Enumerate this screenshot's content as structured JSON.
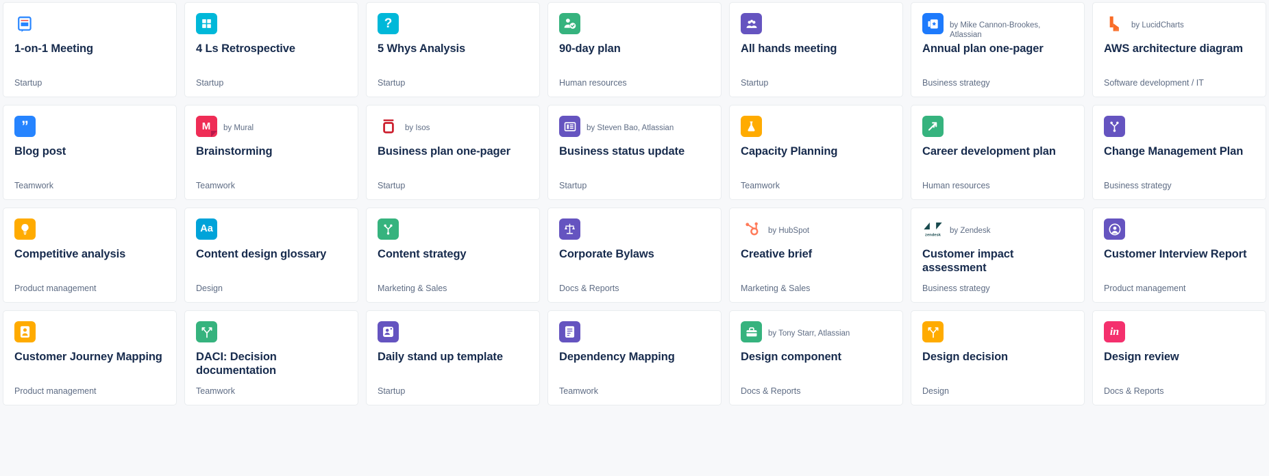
{
  "gallery": {
    "columns": 7,
    "cards": [
      {
        "icon": "one-on-one-meeting-icon",
        "icon_bg": "#ffffff",
        "icon_fg": "#2684ff",
        "title": "1-on-1 Meeting",
        "author": "",
        "category": "Startup"
      },
      {
        "icon": "grid-squares-icon",
        "icon_bg": "#00b8d9",
        "icon_fg": "#ffffff",
        "title": "4 Ls Retrospective",
        "author": "",
        "category": "Startup"
      },
      {
        "icon": "question-mark-icon",
        "icon_bg": "#00b8d9",
        "icon_fg": "#ffffff",
        "title": "5 Whys Analysis",
        "author": "",
        "category": "Startup"
      },
      {
        "icon": "person-check-icon",
        "icon_bg": "#36b37e",
        "icon_fg": "#ffffff",
        "title": "90-day plan",
        "author": "",
        "category": "Human resources"
      },
      {
        "icon": "people-group-icon",
        "icon_bg": "#6554c0",
        "icon_fg": "#ffffff",
        "title": "All hands meeting",
        "author": "",
        "category": "Startup"
      },
      {
        "icon": "plan-star-icon",
        "icon_bg": "#1d7afc",
        "icon_fg": "#ffffff",
        "title": "Annual plan one-pager",
        "author": "by Mike Cannon-Brookes, Atlassian",
        "category": "Business strategy"
      },
      {
        "icon": "lucidcharts-logo-icon",
        "icon_bg": "#ffffff",
        "icon_fg": "#f96c27",
        "title": "AWS architecture diagram",
        "author": "by LucidCharts",
        "category": "Software development / IT"
      },
      {
        "icon": "quote-marks-icon",
        "icon_bg": "#2684ff",
        "icon_fg": "#ffffff",
        "title": "Blog post",
        "author": "",
        "category": "Teamwork"
      },
      {
        "icon": "mural-logo-icon",
        "icon_bg": "#ef2d56",
        "icon_fg": "#ffffff",
        "title": "Brainstorming",
        "author": "by Mural",
        "category": "Teamwork"
      },
      {
        "icon": "isos-logo-icon",
        "icon_bg": "#ffffff",
        "icon_fg": "#cc1e2d",
        "title": "Business plan one-pager",
        "author": "by Isos",
        "category": "Startup"
      },
      {
        "icon": "newspaper-icon",
        "icon_bg": "#6554c0",
        "icon_fg": "#ffffff",
        "title": "Business status update",
        "author": "by Steven Bao, Atlassian",
        "category": "Startup"
      },
      {
        "icon": "flask-icon",
        "icon_bg": "#ffab00",
        "icon_fg": "#ffffff",
        "title": "Capacity Planning",
        "author": "",
        "category": "Teamwork"
      },
      {
        "icon": "growth-arrow-icon",
        "icon_bg": "#36b37e",
        "icon_fg": "#ffffff",
        "title": "Career development plan",
        "author": "",
        "category": "Human resources"
      },
      {
        "icon": "branch-fork-icon",
        "icon_bg": "#6554c0",
        "icon_fg": "#ffffff",
        "title": "Change Management Plan",
        "author": "",
        "category": "Business strategy"
      },
      {
        "icon": "lightbulb-icon",
        "icon_bg": "#ffab00",
        "icon_fg": "#ffffff",
        "title": "Competitive analysis",
        "author": "",
        "category": "Product management"
      },
      {
        "icon": "typography-aa-icon",
        "icon_bg": "#00a3d9",
        "icon_fg": "#ffffff",
        "title": "Content design glossary",
        "author": "",
        "category": "Design"
      },
      {
        "icon": "branch-fork-icon",
        "icon_bg": "#36b37e",
        "icon_fg": "#ffffff",
        "title": "Content strategy",
        "author": "",
        "category": "Marketing & Sales"
      },
      {
        "icon": "scales-balance-icon",
        "icon_bg": "#6554c0",
        "icon_fg": "#ffffff",
        "title": "Corporate Bylaws",
        "author": "",
        "category": "Docs & Reports"
      },
      {
        "icon": "hubspot-logo-icon",
        "icon_bg": "#ffffff",
        "icon_fg": "#ff7a59",
        "title": "Creative brief",
        "author": "by HubSpot",
        "category": "Marketing & Sales"
      },
      {
        "icon": "zendesk-logo-icon",
        "icon_bg": "#ffffff",
        "icon_fg": "#17494d",
        "title": "Customer impact assessment",
        "author": "by Zendesk",
        "category": "Business strategy"
      },
      {
        "icon": "person-circle-icon",
        "icon_bg": "#6554c0",
        "icon_fg": "#ffffff",
        "title": "Customer Interview Report",
        "author": "",
        "category": "Product management"
      },
      {
        "icon": "person-badge-icon",
        "icon_bg": "#ffab00",
        "icon_fg": "#ffffff",
        "title": "Customer Journey Mapping",
        "author": "",
        "category": "Product management"
      },
      {
        "icon": "decision-fork-icon",
        "icon_bg": "#36b37e",
        "icon_fg": "#ffffff",
        "title": "DACI: Decision documentation",
        "author": "",
        "category": "Teamwork"
      },
      {
        "icon": "person-speech-icon",
        "icon_bg": "#6554c0",
        "icon_fg": "#ffffff",
        "title": "Daily stand up template",
        "author": "",
        "category": "Startup"
      },
      {
        "icon": "document-lines-icon",
        "icon_bg": "#6554c0",
        "icon_fg": "#ffffff",
        "title": "Dependency Mapping",
        "author": "",
        "category": "Teamwork"
      },
      {
        "icon": "toolbox-icon",
        "icon_bg": "#36b37e",
        "icon_fg": "#ffffff",
        "title": "Design component",
        "author": "by Tony Starr, Atlassian",
        "category": "Docs & Reports"
      },
      {
        "icon": "decision-fork-icon",
        "icon_bg": "#ffab00",
        "icon_fg": "#ffffff",
        "title": "Design decision",
        "author": "",
        "category": "Design"
      },
      {
        "icon": "invision-logo-icon",
        "icon_bg": "#f4306d",
        "icon_fg": "#ffffff",
        "title": "Design review",
        "author": "",
        "category": "Docs & Reports"
      }
    ]
  }
}
